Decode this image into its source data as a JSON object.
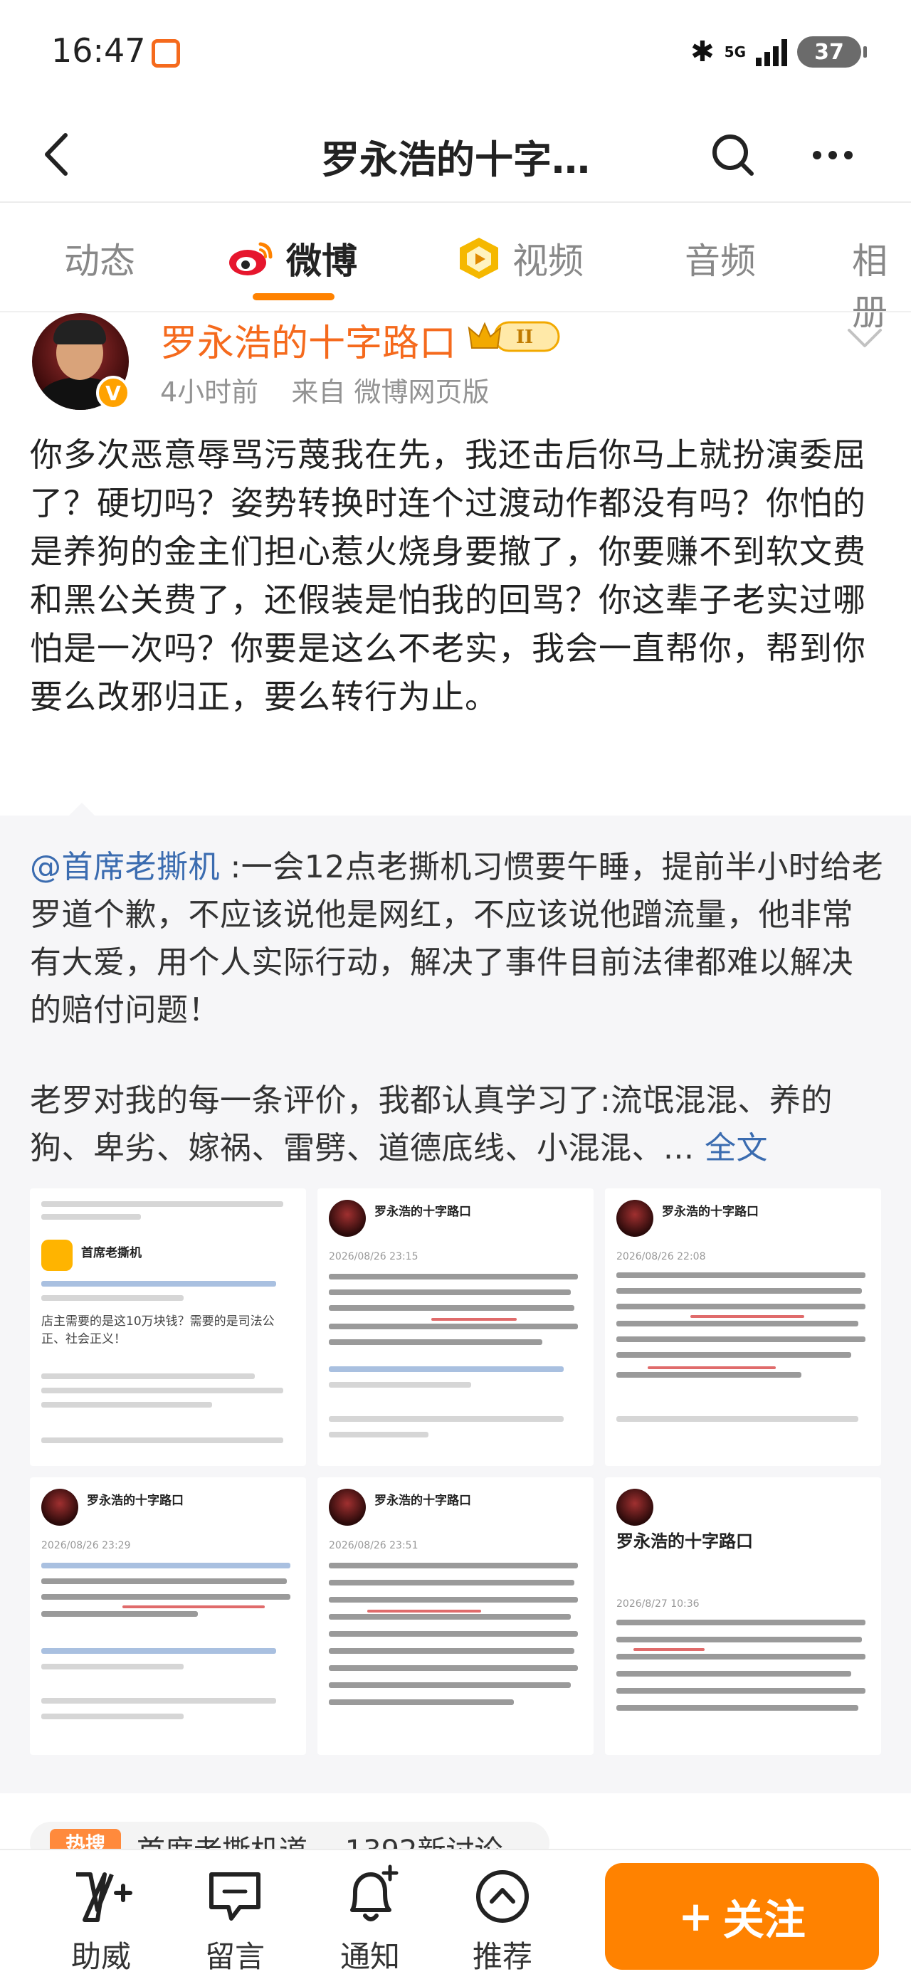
{
  "status_bar": {
    "time": "16:47",
    "network": "5G",
    "battery": "37"
  },
  "header": {
    "title": "罗永浩的十字…"
  },
  "tabs": [
    {
      "label": "动态"
    },
    {
      "label": "微博"
    },
    {
      "label": "视频"
    },
    {
      "label": "音频"
    },
    {
      "label": "相册"
    }
  ],
  "post": {
    "author": "罗永浩的十字路口",
    "badge_level": "II",
    "verified_mark": "V",
    "time": "4小时前",
    "source": "来自 微博网页版",
    "body": "你多次恶意辱骂污蔑我在先，我还击后你马上就扮演委屈了？硬切吗？姿势转换时连个过渡动作都没有吗？你怕的是养狗的金主们担心惹火烧身要撤了，你要赚不到软文费和黑公关费了，还假装是怕我的回骂？你这辈子老实过哪怕是一次吗？你要是这么不老实，我会一直帮你，帮到你要么改邪归正，要么转行为止。"
  },
  "retweet": {
    "mention": "@首席老撕机",
    "text1": " :一会12点老撕机习惯要午睡，提前半小时给老罗道个歉，不应该说他是网红，不应该说他蹭流量，他非常有大爱，用个人实际行动，解决了事件目前法律都难以解决的赔付问题！",
    "text2": "老罗对我的每一条评价，我都认真学习了:流氓混混、养的狗、卑劣、嫁祸、雷劈、道德底线、小混混、...",
    "full_text_link": "全文"
  },
  "images": [
    {
      "caption": "首席老撕机",
      "line": "店主需要的是这10万块钱？需要的是司法公正、社会正义！"
    },
    {
      "caption": "罗永浩的十字路口",
      "line": "2026/08/26 23:15"
    },
    {
      "caption": "罗永浩的十字路口",
      "line": "2026/08/26 22:08"
    },
    {
      "caption": "罗永浩的十字路口",
      "line": "2026/08/26 23:29"
    },
    {
      "caption": "罗永浩的十字路口",
      "line": "2026/08/26 23:51"
    },
    {
      "caption": "罗永浩的十字路口",
      "line": "2026/8/27 10:36"
    }
  ],
  "trending": {
    "tag": "热搜",
    "text": "首席老撕机道… 1392新讨论"
  },
  "bottom_bar": {
    "items": [
      {
        "label": "助威"
      },
      {
        "label": "留言"
      },
      {
        "label": "通知"
      },
      {
        "label": "推荐"
      }
    ],
    "follow_label": "关注",
    "follow_plus": "+"
  },
  "colors": {
    "accent": "#ff8200",
    "author": "#f56a1d",
    "link": "#3b6cb0"
  }
}
